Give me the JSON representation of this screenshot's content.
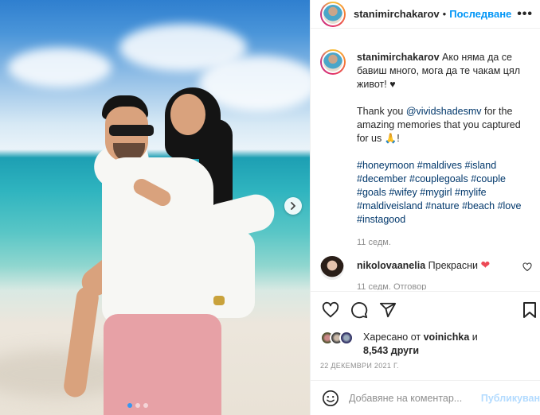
{
  "post": {
    "username": "stanimirchakarov",
    "separator": "•",
    "follow_label": "Последване",
    "more_icon": "•••"
  },
  "caption": {
    "username": "stanimirchakarov",
    "line1": "Ако няма да се бавиш много, мога да те чакам цял живот! ♥",
    "thanks_prefix": "Thank you ",
    "thanks_mention": "@vividshadesmv",
    "thanks_suffix": " for the amazing memories that you captured for us 🙏!",
    "hashtags": [
      "#honeymoon",
      "#maldives",
      "#island",
      "#december",
      "#couplegoals",
      "#couple",
      "#goals",
      "#wifey",
      "#mygirl",
      "#mylife",
      "#maldiveisland",
      "#nature",
      "#beach",
      "#love",
      "#instagood"
    ],
    "time": "11 седм."
  },
  "comment": {
    "username": "nikolovaanelia",
    "text": "Прекрасни",
    "emoji": "❤",
    "meta": "11 седм.   Отговор"
  },
  "likes": {
    "liked_by_prefix": "Харесано от ",
    "liked_by_user": "voinichka",
    "liked_by_mid": " и",
    "count": "8,543",
    "count_suffix": " други"
  },
  "date": "22 ДЕКЕМВРИ 2021 Г.",
  "add_comment": {
    "placeholder": "Добавяне на коментар...",
    "post_label": "Публикуване"
  },
  "carousel": {
    "slide_count": 3,
    "active_index": 0
  },
  "colors": {
    "accent": "#0095f6",
    "heart": "#ed4956",
    "muted": "#8e8e8e"
  }
}
